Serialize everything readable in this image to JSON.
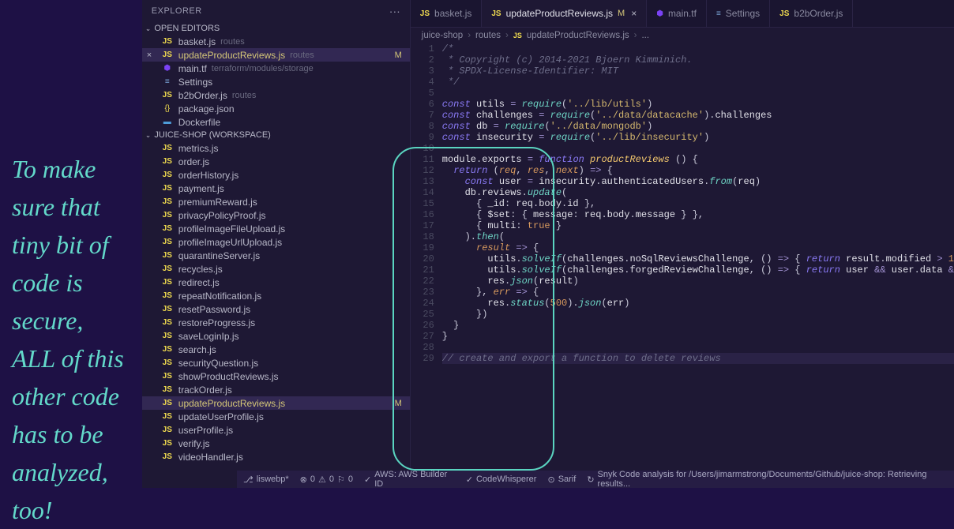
{
  "annotation": "To make sure that tiny bit of code is secure, ALL of this other code has to be analyzed, too!",
  "explorer": {
    "title": "Explorer",
    "sections": {
      "openEditors": "Open Editors",
      "workspace": "JUICE-SHOP (WORKSPACE)"
    }
  },
  "openEditors": [
    {
      "icon": "JS",
      "name": "basket.js",
      "path": "routes",
      "iconClass": "icon-js"
    },
    {
      "icon": "JS",
      "name": "updateProductReviews.js",
      "path": "routes",
      "iconClass": "icon-js",
      "active": true,
      "modified": true,
      "close": true
    },
    {
      "icon": "⬢",
      "name": "main.tf",
      "path": "terraform/modules/storage",
      "iconClass": "icon-tf"
    },
    {
      "icon": "≡",
      "name": "Settings",
      "iconClass": "icon-set"
    },
    {
      "icon": "JS",
      "name": "b2bOrder.js",
      "path": "routes",
      "iconClass": "icon-js"
    },
    {
      "icon": "{}",
      "name": "package.json",
      "iconClass": "icon-json"
    },
    {
      "icon": "▬",
      "name": "Dockerfile",
      "iconClass": "icon-docker"
    }
  ],
  "workspaceFiles": [
    {
      "name": "metrics.js"
    },
    {
      "name": "order.js"
    },
    {
      "name": "orderHistory.js"
    },
    {
      "name": "payment.js"
    },
    {
      "name": "premiumReward.js"
    },
    {
      "name": "privacyPolicyProof.js"
    },
    {
      "name": "profileImageFileUpload.js"
    },
    {
      "name": "profileImageUrlUpload.js"
    },
    {
      "name": "quarantineServer.js"
    },
    {
      "name": "recycles.js"
    },
    {
      "name": "redirect.js"
    },
    {
      "name": "repeatNotification.js"
    },
    {
      "name": "resetPassword.js"
    },
    {
      "name": "restoreProgress.js"
    },
    {
      "name": "saveLoginIp.js"
    },
    {
      "name": "search.js"
    },
    {
      "name": "securityQuestion.js"
    },
    {
      "name": "showProductReviews.js"
    },
    {
      "name": "trackOrder.js"
    },
    {
      "name": "updateProductReviews.js",
      "active": true,
      "modified": true
    },
    {
      "name": "updateUserProfile.js"
    },
    {
      "name": "userProfile.js"
    },
    {
      "name": "verify.js"
    },
    {
      "name": "videoHandler.js"
    }
  ],
  "tabs": [
    {
      "icon": "JS",
      "label": "basket.js",
      "iconClass": "icon-js"
    },
    {
      "icon": "JS",
      "label": "updateProductReviews.js",
      "iconClass": "icon-js",
      "active": true,
      "modified": "M",
      "close": true
    },
    {
      "icon": "⬢",
      "label": "main.tf",
      "iconClass": "icon-tf"
    },
    {
      "icon": "≡",
      "label": "Settings",
      "iconClass": "icon-set"
    },
    {
      "icon": "JS",
      "label": "b2bOrder.js",
      "iconClass": "icon-js"
    }
  ],
  "breadcrumb": [
    "juice-shop",
    "routes",
    "updateProductReviews.js",
    "..."
  ],
  "breadcrumbIcon": "JS",
  "code": {
    "lines": [
      {
        "n": 1,
        "t": "comment",
        "text": "/*"
      },
      {
        "n": 2,
        "t": "comment",
        "text": " * Copyright (c) 2014-2021 Bjoern Kimminich."
      },
      {
        "n": 3,
        "t": "comment",
        "text": " * SPDX-License-Identifier: MIT"
      },
      {
        "n": 4,
        "t": "comment",
        "text": " */"
      },
      {
        "n": 5,
        "t": "blank",
        "text": ""
      },
      {
        "n": 6,
        "t": "code"
      },
      {
        "n": 7,
        "t": "code"
      },
      {
        "n": 8,
        "t": "code"
      },
      {
        "n": 9,
        "t": "code"
      },
      {
        "n": 10,
        "t": "blank",
        "text": ""
      },
      {
        "n": 11,
        "t": "code"
      },
      {
        "n": 12,
        "t": "code"
      },
      {
        "n": 13,
        "t": "code"
      },
      {
        "n": 14,
        "t": "code"
      },
      {
        "n": 15,
        "t": "code"
      },
      {
        "n": 16,
        "t": "code"
      },
      {
        "n": 17,
        "t": "code"
      },
      {
        "n": 18,
        "t": "code"
      },
      {
        "n": 19,
        "t": "code"
      },
      {
        "n": 20,
        "t": "code"
      },
      {
        "n": 21,
        "t": "code"
      },
      {
        "n": 22,
        "t": "code"
      },
      {
        "n": 23,
        "t": "code"
      },
      {
        "n": 24,
        "t": "code"
      },
      {
        "n": 25,
        "t": "code"
      },
      {
        "n": 26,
        "t": "code"
      },
      {
        "n": 27,
        "t": "code"
      },
      {
        "n": 28,
        "t": "blank",
        "text": ""
      },
      {
        "n": 29,
        "t": "comment",
        "text": "// create and export a function to delete reviews"
      }
    ],
    "strings": {
      "utils": "'../lib/utils'",
      "datacache": "'../data/datacache'",
      "mongodb": "'../data/mongodb'",
      "insecurity": "'../lib/insecurity'"
    },
    "identifiers": {
      "const": "const",
      "utils": "utils",
      "challenges": "challenges",
      "db": "db",
      "insecurity": "insecurity",
      "require": "require",
      "module": "module",
      "exports": "exports",
      "function": "function",
      "productReviews": "productReviews",
      "return": "return",
      "req": "req",
      "res": "res",
      "next": "next",
      "user": "user",
      "authenticatedUsers": "authenticatedUsers",
      "from": "from",
      "reviews": "reviews",
      "update": "update",
      "id": "_id",
      "body": "body",
      "bodyId": "id",
      "set": "$set",
      "message": "message",
      "multi": "multi",
      "true": "true",
      "then": "then",
      "result": "result",
      "solveIf": "solveIf",
      "noSqlReviewsChallenge": "noSqlReviewsChallenge",
      "forgedReviewChallenge": "forgedReviewChallenge",
      "modified": "modified",
      "data": "data",
      "json": "json",
      "err": "err",
      "status": "status",
      "500": "500",
      "1": "1"
    }
  },
  "statusbar": {
    "branch": "liswebp*",
    "errors": "0",
    "warnings": "0",
    "ports": "0",
    "aws": "AWS: AWS Builder ID",
    "whisperer": "CodeWhisperer",
    "sarif": "Sarif",
    "snyk": "Snyk Code analysis for /Users/jimarmstrong/Documents/Github/juice-shop: Retrieving results..."
  }
}
